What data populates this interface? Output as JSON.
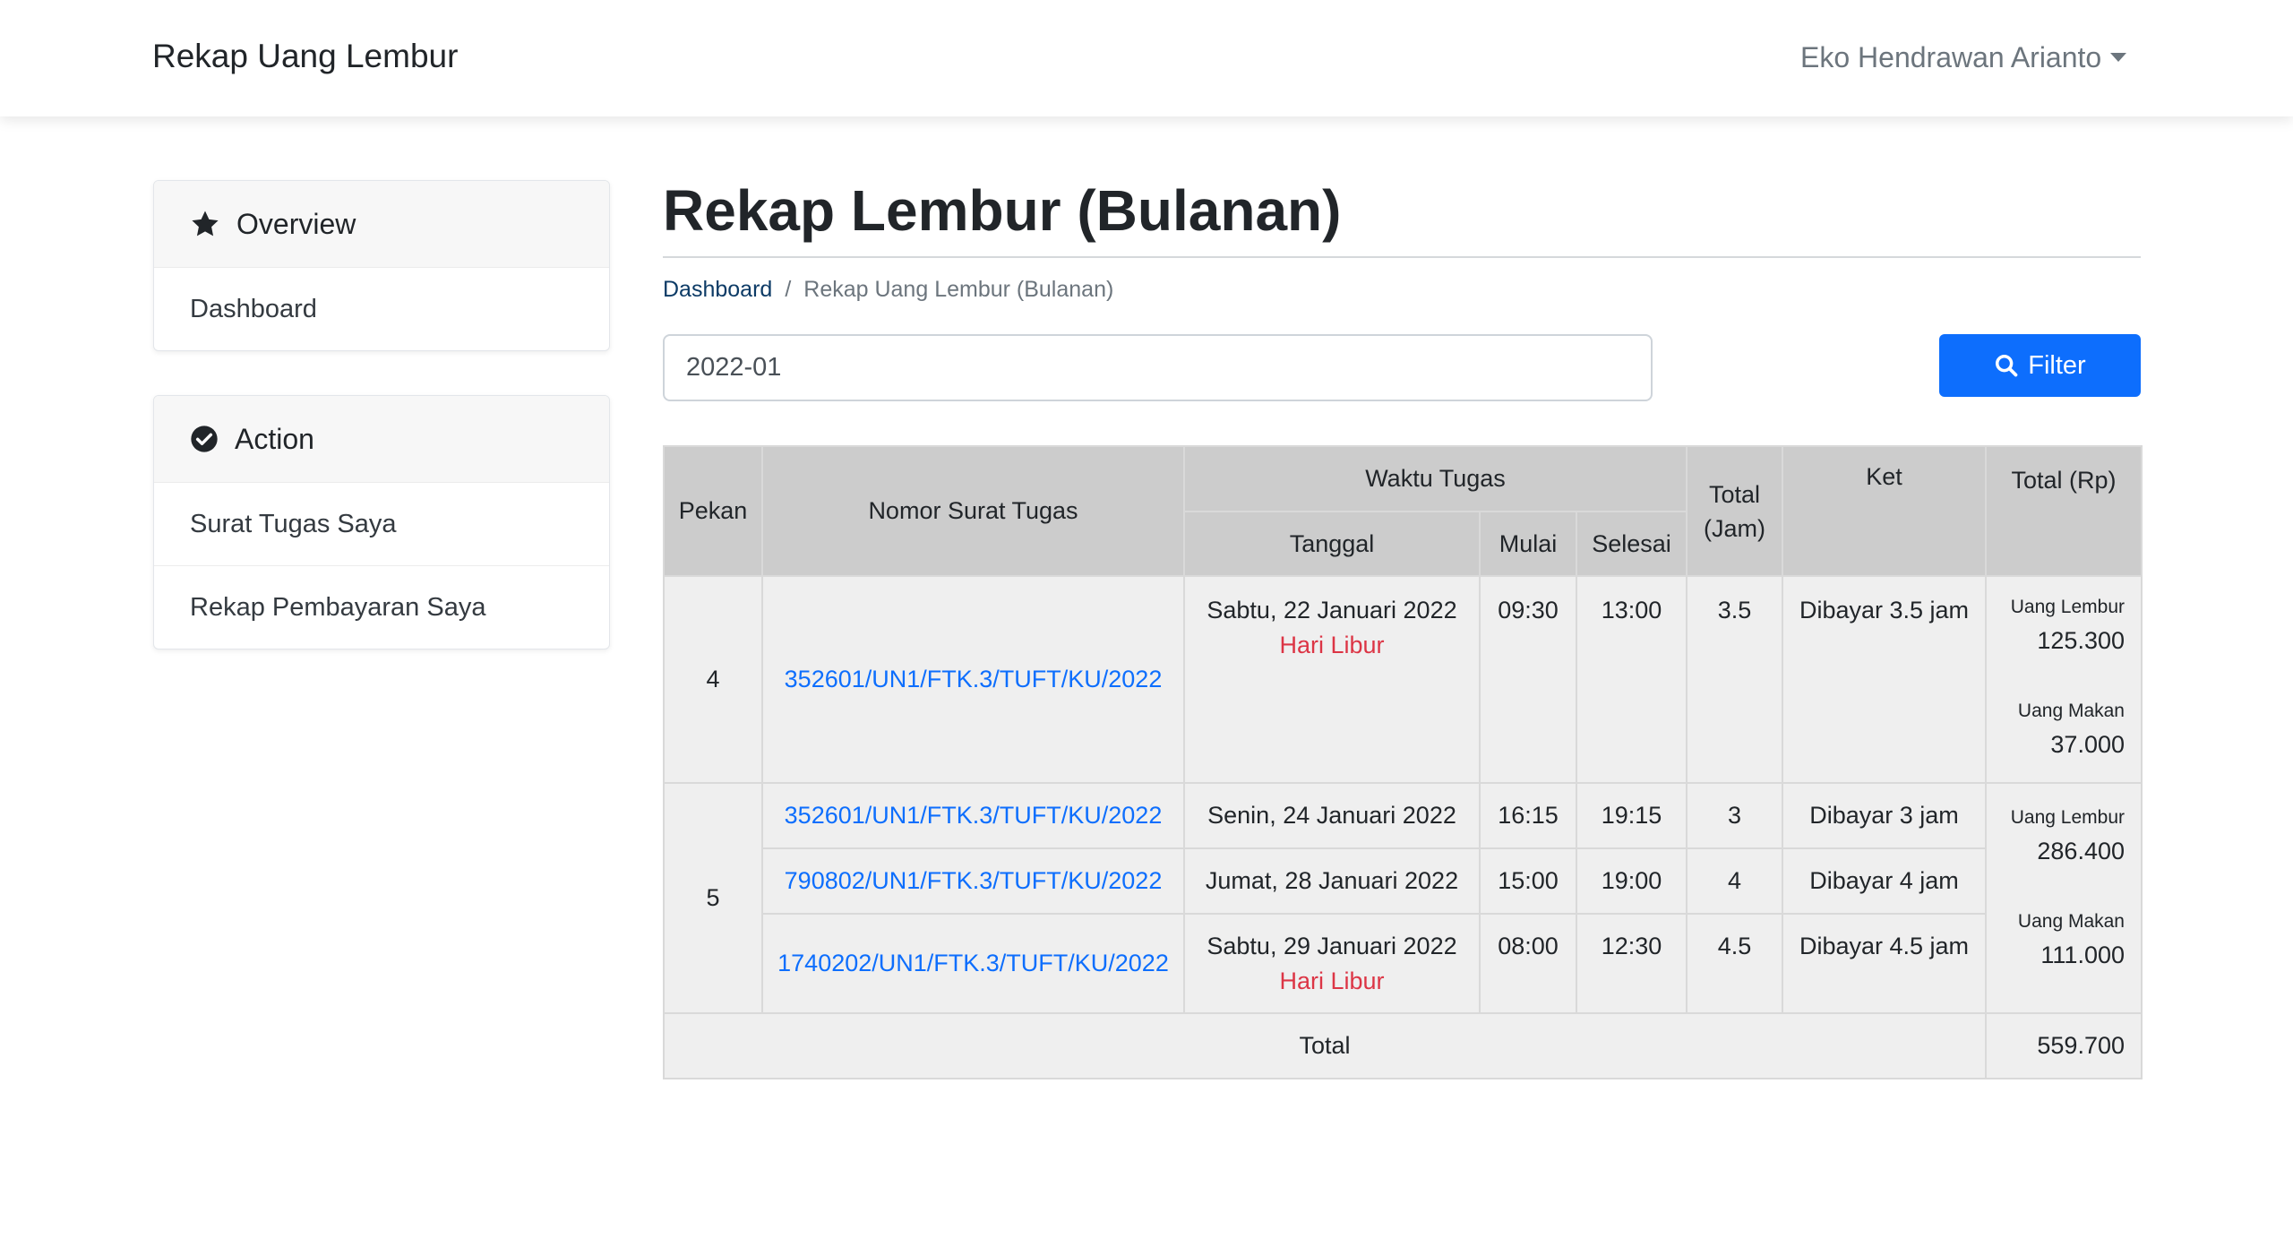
{
  "navbar": {
    "brand": "Rekap Uang Lembur",
    "user": "Eko Hendrawan Arianto"
  },
  "sidebar": {
    "overview": {
      "title": "Overview",
      "icon": "star-icon",
      "items": [
        "Dashboard"
      ]
    },
    "action": {
      "title": "Action",
      "icon": "check-circle-icon",
      "items": [
        "Surat Tugas Saya",
        "Rekap Pembayaran Saya"
      ]
    }
  },
  "main": {
    "title": "Rekap Lembur (Bulanan)",
    "breadcrumb": {
      "home": "Dashboard",
      "separator": "/",
      "current": "Rekap Uang Lembur (Bulanan)"
    },
    "filter": {
      "value": "2022-01",
      "button": "Filter",
      "icon": "search-icon"
    }
  },
  "table": {
    "headers": {
      "pekan": "Pekan",
      "nomor": "Nomor Surat Tugas",
      "waktu": "Waktu Tugas",
      "tanggal": "Tanggal",
      "mulai": "Mulai",
      "selesai": "Selesai",
      "total_jam": "Total (Jam)",
      "ket": "Ket",
      "total_rp": "Total (Rp)"
    },
    "weeks": [
      {
        "pekan": "4",
        "uang_lembur_label": "Uang Lembur",
        "uang_lembur": "125.300",
        "uang_makan_label": "Uang Makan",
        "uang_makan": "37.000",
        "rows": [
          {
            "nomor": "352601/UN1/FTK.3/TUFT/KU/2022",
            "tanggal": "Sabtu, 22 Januari 2022",
            "libur": "Hari Libur",
            "mulai": "09:30",
            "selesai": "13:00",
            "jam": "3.5",
            "ket": "Dibayar 3.5 jam"
          }
        ]
      },
      {
        "pekan": "5",
        "uang_lembur_label": "Uang Lembur",
        "uang_lembur": "286.400",
        "uang_makan_label": "Uang Makan",
        "uang_makan": "111.000",
        "rows": [
          {
            "nomor": "352601/UN1/FTK.3/TUFT/KU/2022",
            "tanggal": "Senin, 24 Januari 2022",
            "mulai": "16:15",
            "selesai": "19:15",
            "jam": "3",
            "ket": "Dibayar 3 jam"
          },
          {
            "nomor": "790802/UN1/FTK.3/TUFT/KU/2022",
            "tanggal": "Jumat, 28 Januari 2022",
            "mulai": "15:00",
            "selesai": "19:00",
            "jam": "4",
            "ket": "Dibayar 4 jam"
          },
          {
            "nomor": "1740202/UN1/FTK.3/TUFT/KU/2022",
            "tanggal": "Sabtu, 29 Januari 2022",
            "libur": "Hari Libur",
            "mulai": "08:00",
            "selesai": "12:30",
            "jam": "4.5",
            "ket": "Dibayar 4.5 jam"
          }
        ]
      }
    ],
    "footer": {
      "label": "Total",
      "value": "559.700"
    }
  },
  "colors": {
    "primary": "#0d6efd",
    "danger": "#dc3545",
    "header_bg": "#cccccc",
    "body_bg": "#efefef"
  }
}
